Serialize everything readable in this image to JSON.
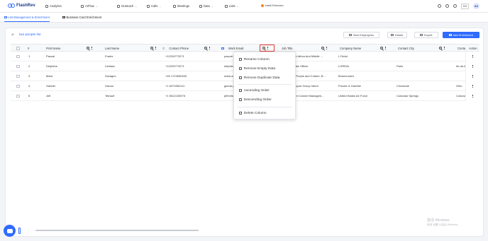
{
  "app": {
    "name": "FlashRev"
  },
  "nav": {
    "items": [
      {
        "label": "Analytics",
        "icon": "analytics-icon"
      },
      {
        "label": "AIFlow",
        "icon": "aiflow-icon"
      },
      {
        "label": "Outreach",
        "icon": "outreach-icon"
      },
      {
        "label": "Calls",
        "icon": "phone-icon"
      },
      {
        "label": "Meetings",
        "icon": "meetings-icon"
      },
      {
        "label": "Data",
        "icon": "data-icon"
      },
      {
        "label": "Lists",
        "icon": "lists-icon"
      }
    ],
    "extension_label": "Install Extension",
    "language": "EN",
    "avatar_initials": "AD"
  },
  "subtabs": [
    {
      "label": "List Management & Enrichment",
      "active": true
    },
    {
      "label": "Business Card Enrichment",
      "active": false
    }
  ],
  "toolbar": {
    "list_name": "two people list",
    "view_employees": "View Employees",
    "delete": "Delete",
    "export": "Export",
    "add_enrichment": "Add Enrichment"
  },
  "table": {
    "headers": {
      "index": "#",
      "first_name": "First Name",
      "last_name": "Last Name",
      "contact_phone": "Contact Phone",
      "work_email": "Work Email",
      "job_title": "Job Title",
      "company_name": "Company Name",
      "contact_city": "Contact City",
      "contact_state": "Conta",
      "action": "Action"
    },
    "rows": [
      {
        "index": "1",
        "first": "Pascal",
        "last": "Frantz",
        "phone": "+12226773271",
        "email": "pascal.fran",
        "title": "...e Africa And Middle ...",
        "company": "L'Oréal",
        "city": "",
        "state": ""
      },
      {
        "index": "2",
        "first": "Delphine",
        "last": "Leblanc",
        "phone": "+12226773271",
        "email": "delphine.le",
        "title": "...ate Officer",
        "company": "LOREAL",
        "city": "Paris",
        "state": "Ile-de-fr"
      },
      {
        "index": "3",
        "first": "Mara",
        "last": "Zavagno",
        "phone": "+49 1723050543",
        "email": "mara.zavag",
        "title": "...People and Culture, B...",
        "company": "Bonecrusers",
        "city": "",
        "state": ""
      },
      {
        "index": "4",
        "first": "Gabriel",
        "last": "Garcia",
        "phone": "+1 6073352111",
        "email": "garcia.g@p",
        "title": "...pport Group Intern",
        "company": "Procter & Gamble",
        "city": "Cincinnati",
        "state": "Ohio"
      },
      {
        "index": "5",
        "first": "Jeff",
        "last": "Tetrault",
        "phone": "+1 5612130975",
        "email": "jeff.tetrault",
        "title": "...nt Colonel Managem...",
        "company": "United States Air Force",
        "city": "Colorado Springs",
        "state": "Colorad"
      }
    ]
  },
  "column_menu": {
    "items": [
      {
        "label": "Rename Column",
        "icon": "rename-icon"
      },
      {
        "label": "Remove Empty Data",
        "icon": "remove-empty-icon"
      },
      {
        "label": "Remove Duplicate Data",
        "icon": "remove-duplicate-icon"
      },
      {
        "label": "Ascending Order",
        "icon": "sort-ascending-icon"
      },
      {
        "label": "Descending Order",
        "icon": "sort-descending-icon"
      },
      {
        "label": "Delete Column",
        "icon": "trash-icon"
      }
    ]
  },
  "watermark": {
    "line1": "激活 Windows",
    "line2": "转到\"设置\"以激活 Windows。"
  },
  "colors": {
    "accent": "#2f6bff",
    "highlight": "#e53935"
  }
}
